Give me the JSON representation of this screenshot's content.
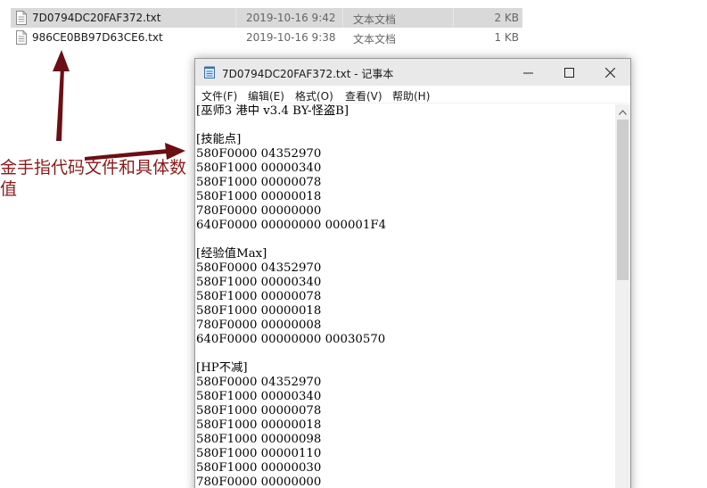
{
  "explorer": {
    "files": [
      {
        "name": "7D0794DC20FAF372.txt",
        "date": "2019-10-16 9:42",
        "type": "文本文档",
        "size": "2 KB",
        "selected": true
      },
      {
        "name": "986CE0BB97D63CE6.txt",
        "date": "2019-10-16 9:38",
        "type": "文本文档",
        "size": "1 KB",
        "selected": false
      }
    ]
  },
  "annotation": {
    "text": "金手指代码文件和具体数值",
    "color": "#8b1a1a"
  },
  "notepad": {
    "title": "7D0794DC20FAF372.txt - 记事本",
    "menu": [
      "文件(F)",
      "编辑(E)",
      "格式(O)",
      "查看(V)",
      "帮助(H)"
    ],
    "content": "[巫师3 港中 v3.4 BY-怪盗B]\n\n[技能点]\n580F0000 04352970\n580F1000 00000340\n580F1000 00000078\n580F1000 00000018\n780F0000 00000000\n640F0000 00000000 000001F4\n\n[经验值Max]\n580F0000 04352970\n580F1000 00000340\n580F1000 00000078\n580F1000 00000018\n780F0000 00000008\n640F0000 00000000 00030570\n\n[HP不减]\n580F0000 04352970\n580F1000 00000340\n580F1000 00000078\n580F1000 00000018\n580F1000 00000098\n580F1000 00000110\n580F1000 00000030\n780F0000 00000000"
  }
}
